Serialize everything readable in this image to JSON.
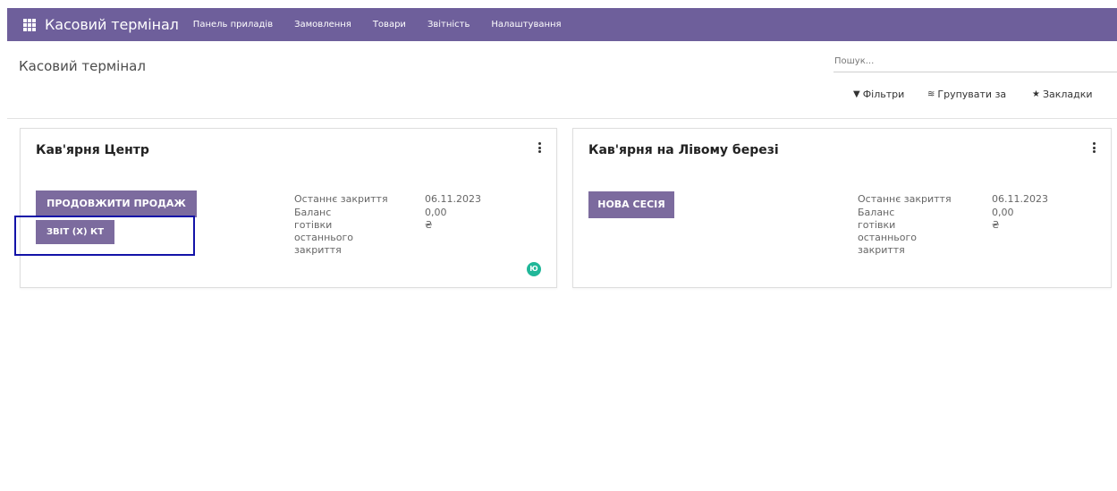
{
  "navbar": {
    "app_title": "Касовий термінал",
    "menu": [
      "Панель приладів",
      "Замовлення",
      "Товари",
      "Звітність",
      "Налаштування"
    ]
  },
  "control_panel": {
    "breadcrumb": "Касовий термінал",
    "search_placeholder": "Пошук...",
    "filters_label": "Фільтри",
    "group_by_label": "Групувати за",
    "favorites_label": "Закладки"
  },
  "cards": [
    {
      "title": "Кав'ярня Центр",
      "primary_button": "ПРОДОВЖИТИ ПРОДАЖ",
      "secondary_button": "ЗВІТ (Х) КТ",
      "last_closing_label": "Останнє закриття",
      "last_closing_value": "06.11.2023",
      "balance_label": "Баланс готівки останнього закриття",
      "balance_value": "0,00 ₴",
      "avatar_initial": "Ю"
    },
    {
      "title": "Кав'ярня на Лівому березі",
      "primary_button": "НОВА СЕСІЯ",
      "last_closing_label": "Останнє закриття",
      "last_closing_value": "06.11.2023",
      "balance_label": "Баланс готівки останнього закриття",
      "balance_value": "0,00 ₴"
    }
  ],
  "colors": {
    "navbar": "#6e5f9b",
    "button": "#7c6b9e",
    "avatar": "#21b799",
    "highlight": "#1313a8"
  }
}
